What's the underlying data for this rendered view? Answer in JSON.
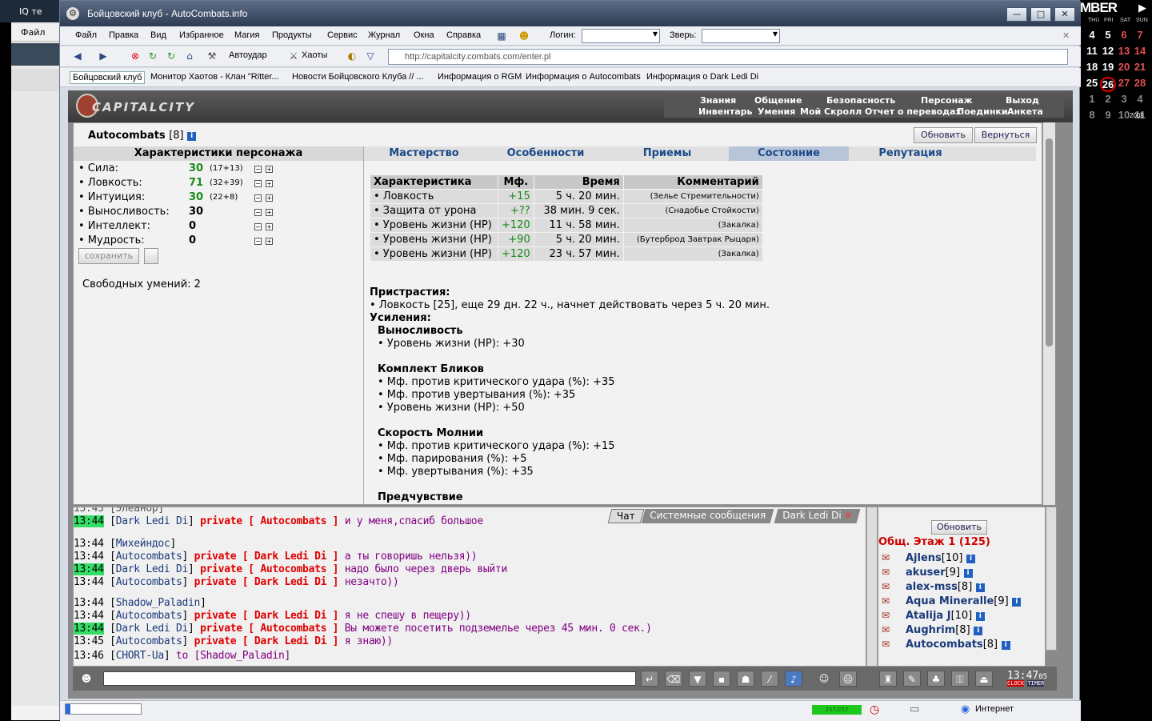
{
  "window": {
    "title": "Бойцовский клуб - AutoCombats.info"
  },
  "menu": {
    "items": [
      "Файл",
      "Правка",
      "Вид",
      "Избранное",
      "Магия",
      "Продукты",
      "Сервис",
      "Журнал",
      "Окна",
      "Справка"
    ],
    "login_label": "Логин:",
    "pet_label": "Зверь:"
  },
  "toolbar": {
    "autoattack": "Автоудар",
    "chaos": "Хаоты",
    "url": "http://capitalcity.combats.com/enter.pl"
  },
  "links": [
    "Бойцовский клуб",
    "Монитор Хаотов - Клан \"Ritter...",
    "Новости Бойцовского Клуба // ...",
    "Информация о RGM",
    "Информация о Autocombats",
    "Информация о Dark Ledi Di"
  ],
  "game": {
    "logo": "CAPITALCITY",
    "nav_top": [
      "Знания",
      "Общение",
      "Безопасность",
      "Персонаж",
      "Выход"
    ],
    "nav_bottom": [
      "Инвентарь",
      "Умения",
      "Мой Скролл",
      "Отчет о переводах",
      "Поединки",
      "Анкета"
    ],
    "char_name": "Autocombats",
    "char_level": "[8]",
    "btn_refresh": "Обновить",
    "btn_back": "Вернуться",
    "char_header": "Характеристики персонажа",
    "tabs": [
      "Мастерство",
      "Особенности",
      "Приемы",
      "Состояние",
      "Репутация"
    ],
    "stats": [
      {
        "label": "• Сила:",
        "value": "30",
        "bonus": "(17+13)"
      },
      {
        "label": "• Ловкость:",
        "value": "71",
        "bonus": "(32+39)"
      },
      {
        "label": "• Интуиция:",
        "value": "30",
        "bonus": "(22+8)"
      },
      {
        "label": "• Выносливость:",
        "value": "30",
        "bonus": ""
      },
      {
        "label": "• Интеллект:",
        "value": "0",
        "bonus": ""
      },
      {
        "label": "• Мудрость:",
        "value": "0",
        "bonus": ""
      }
    ],
    "save_btn": "сохранить",
    "free_skills": "Свободных умений: 2",
    "effects_headers": [
      "Характеристика",
      "Мф.",
      "Время",
      "Комментарий"
    ],
    "effects": [
      [
        "• Ловкость",
        "+15",
        "5 ч. 20 мин.",
        "(Зелье Стремительности)"
      ],
      [
        "• Защита от урона",
        "+??",
        "38 мин. 9 сек.",
        "(Снадобье Стойкости)"
      ],
      [
        "• Уровень жизни (HP)",
        "+120",
        "11 ч. 58 мин.",
        "(Закалка)"
      ],
      [
        "• Уровень жизни (HP)",
        "+90",
        "5 ч. 20 мин.",
        "(Бутерброд Завтрак Рыцаря)"
      ],
      [
        "• Уровень жизни (HP)",
        "+120",
        "23 ч. 57 мин.",
        "(Закалка)"
      ]
    ],
    "addictions_title": "Пристрастия:",
    "addictions_line": "• Ловкость [25], еще 29 дн. 22 ч., начнет действовать через 5 ч. 20 мин.",
    "boosts_title": "Усиления:",
    "boost1_title": "Выносливость",
    "boost1_lines": [
      "• Уровень жизни (HP): +30"
    ],
    "boost2_title": "Комплект Бликов",
    "boost2_lines": [
      "• Мф. против критического удара (%): +35",
      "• Мф. против увертывания (%): +35",
      "• Уровень жизни (HP): +50"
    ],
    "boost3_title": "Скорость Молнии",
    "boost3_lines": [
      "• Мф. против критического удара (%): +15",
      "• Мф. парирования (%): +5",
      "• Мф. увертывания (%): +35"
    ],
    "boost4_title": "Предчувствие"
  },
  "chat": {
    "tabs": [
      "Чат",
      "Системные сообщения",
      "Dark Ledi Di"
    ],
    "lines": [
      {
        "time": "13:44",
        "hl": true,
        "name": "Dark Ledi Di",
        "private": "private [ Autocombats ]",
        "msg": "и у меня,спасиб большое"
      },
      {
        "time": "13:44",
        "hl": false,
        "name": "Михейндос",
        "private": "",
        "msg": ""
      },
      {
        "time": "13:44",
        "hl": false,
        "name": "Autocombats",
        "private": "private [ Dark Ledi Di ]",
        "msg": "а ты говоришь нельзя))"
      },
      {
        "time": "13:44",
        "hl": true,
        "name": "Dark Ledi Di",
        "private": "private [ Autocombats ]",
        "msg": "надо было через дверь выйти"
      },
      {
        "time": "13:44",
        "hl": false,
        "name": "Autocombats",
        "private": "private [ Dark Ledi Di ]",
        "msg": "незачто))"
      },
      {
        "time": "13:44",
        "hl": false,
        "name": "Shadow_Paladin",
        "private": "",
        "msg": ""
      },
      {
        "time": "13:44",
        "hl": false,
        "name": "Autocombats",
        "private": "private [ Dark Ledi Di ]",
        "msg": "я не спешу в пещеру))"
      },
      {
        "time": "13:44",
        "hl": true,
        "name": "Dark Ledi Di",
        "private": "private [ Autocombats ]",
        "msg": "Вы можете посетить подземелье через 45 мин. 0 сек.)"
      },
      {
        "time": "13:45",
        "hl": false,
        "name": "Autocombats",
        "private": "private [ Dark Ledi Di ]",
        "msg": "я знаю))"
      },
      {
        "time": "13:46",
        "hl": false,
        "name": "CHORT-Ua",
        "private": "",
        "msg": "to [Shadow_Paladin]"
      }
    ],
    "cut_line": "13:43 [Элеанор]"
  },
  "users": {
    "refresh": "Обновить",
    "room": "Общ. Этаж 1 (125)",
    "list": [
      {
        "name": "Ajlens",
        "level": "[10]"
      },
      {
        "name": "akuser",
        "level": "[9]"
      },
      {
        "name": "alex-mss",
        "level": "[8]"
      },
      {
        "name": "Aqua Mineralle",
        "level": "[9]"
      },
      {
        "name": "Atalija J",
        "level": "[10]"
      },
      {
        "name": "Aughrim",
        "level": "[8]"
      },
      {
        "name": "Autocombats",
        "level": "[8]"
      }
    ]
  },
  "clock": {
    "time": "13:47",
    "sec": "05",
    "clock_label": "CLOCK",
    "timer_label": "TIMER"
  },
  "status": {
    "hp": "257/257",
    "zone": "Интернет"
  },
  "calendar": {
    "month": "MBER",
    "dow": [
      "THU",
      "FRI",
      "SAT",
      "SUN"
    ],
    "weeks": [
      [
        "4",
        "5",
        "6",
        "7"
      ],
      [
        "11",
        "12",
        "13",
        "14"
      ],
      [
        "18",
        "19",
        "20",
        "21"
      ],
      [
        "25",
        "26",
        "27",
        "28"
      ],
      [
        "1",
        "2",
        "3",
        "4"
      ],
      [
        "8",
        "9",
        "10",
        "11"
      ]
    ],
    "year": "2008"
  },
  "bg": {
    "tab_label": "IQ те",
    "file_label": "Файл"
  }
}
